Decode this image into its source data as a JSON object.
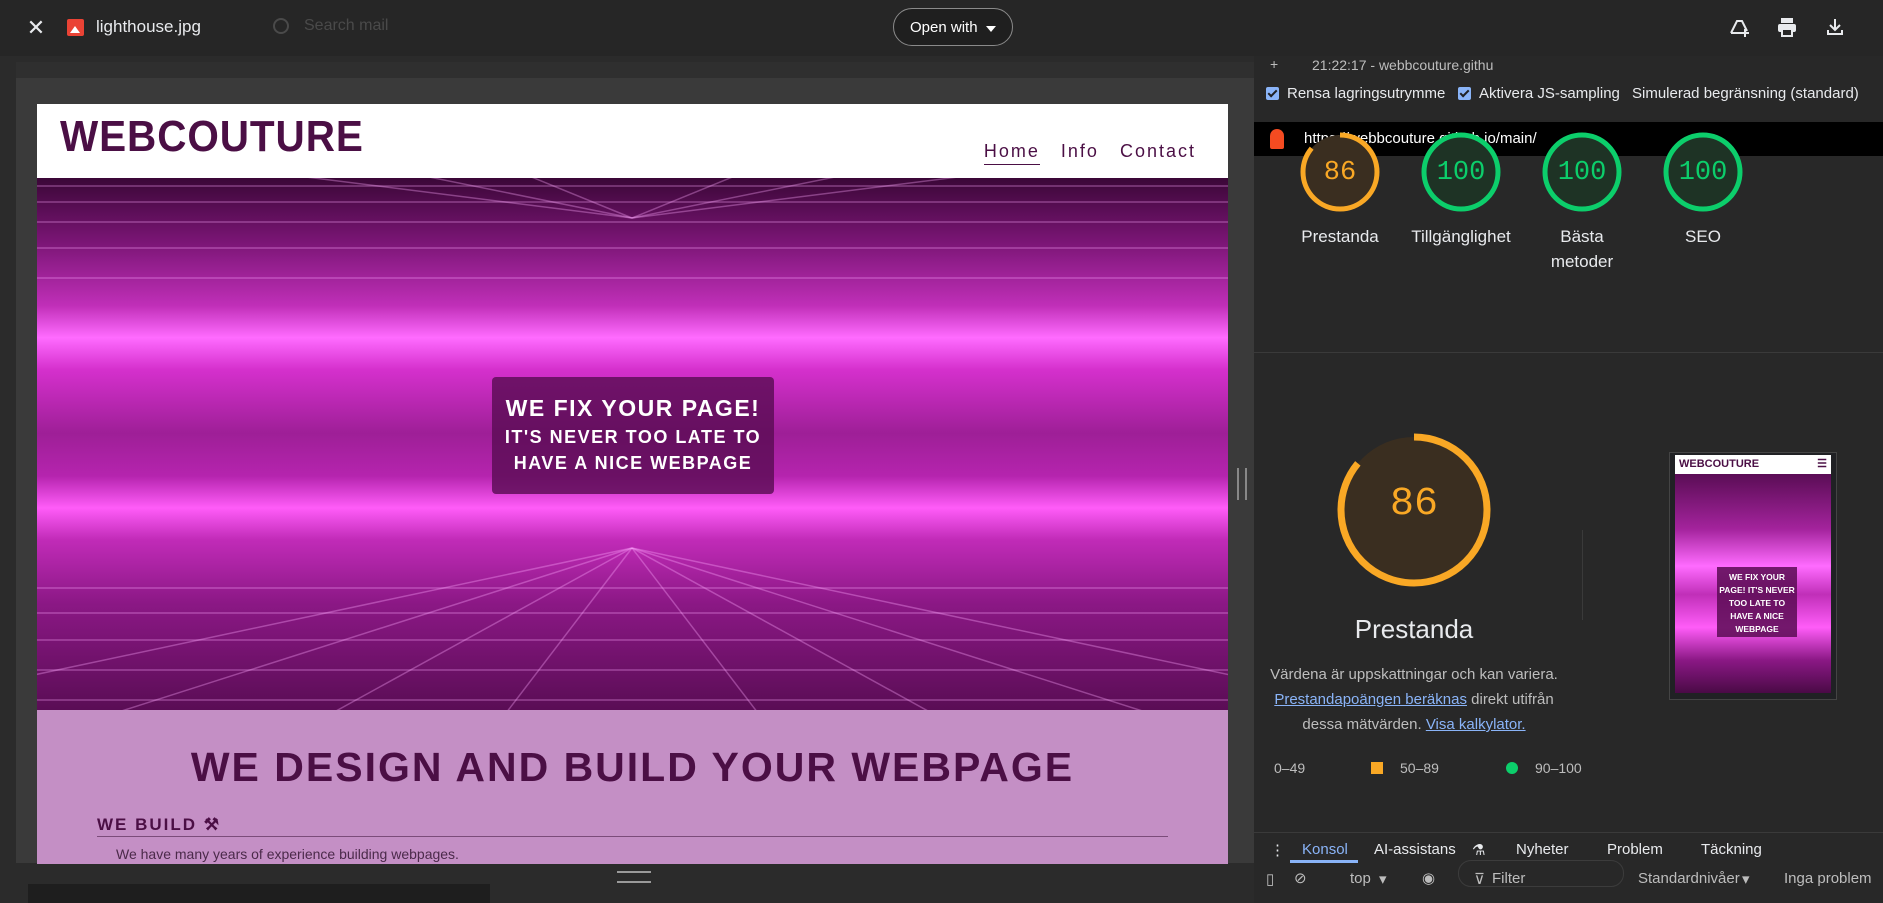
{
  "viewer": {
    "file_name": "lighthouse.jpg",
    "ghost_search": "Search mail",
    "open_with_label": "Open with",
    "icons": [
      "close-icon",
      "image-file-icon",
      "add-to-drive-icon",
      "print-icon",
      "download-icon"
    ]
  },
  "site": {
    "logo": "WEBCOUTURE",
    "nav": [
      "Home",
      "Info",
      "Contact"
    ],
    "hero_line1": "WE FIX YOUR PAGE!",
    "hero_line2": "IT'S NEVER TOO LATE TO",
    "hero_line3": "HAVE A NICE WEBPAGE",
    "section_title": "WE DESIGN AND BUILD YOUR WEBPAGE",
    "build_heading": "WE BUILD ⚒",
    "build_text": "We have many years of experience building webpages.",
    "colors": {
      "brand": "#4b0f45",
      "about_bg": "#c48fc5"
    }
  },
  "devtools": {
    "tab_text": "21:22:17 - webbcouture.githu",
    "options": {
      "clear_storage": "Rensa lagringsutrymme",
      "js_sampling": "Aktivera JS-sampling",
      "throttling": "Simulerad begränsning (standard)"
    },
    "url": "https://webbcouture.github.io/main/",
    "scores": [
      {
        "value": "86",
        "label": "Prestanda",
        "color": "#f9a825"
      },
      {
        "value": "100",
        "label": "Tillgänglighet",
        "color": "#0cce6b"
      },
      {
        "value": "100",
        "label": "Bästa metoder",
        "color": "#0cce6b"
      },
      {
        "value": "100",
        "label": "SEO",
        "color": "#0cce6b"
      }
    ],
    "big_score": {
      "value": "86",
      "label": "Prestanda"
    },
    "desc_1": "Värdena är uppskattningar och kan variera.",
    "desc_link1": "Prestandapoängen beräknas",
    "desc_2": "direkt utifrån dessa mätvärden.",
    "desc_link2": "Visa kalkylator.",
    "legend": [
      "0–49",
      "50–89",
      "90–100"
    ],
    "thumb": {
      "logo": "WEBCOUTURE",
      "card_text": "WE FIX YOUR PAGE! IT'S NEVER TOO LATE TO HAVE A NICE WEBPAGE"
    },
    "console_tabs": [
      "Konsol",
      "AI-assistans",
      "Nyheter",
      "Problem",
      "Täckning"
    ],
    "console_tools": {
      "context": "top",
      "filter_placeholder": "Filter",
      "levels": "Standardnivåer",
      "issues": "Inga problem"
    }
  }
}
